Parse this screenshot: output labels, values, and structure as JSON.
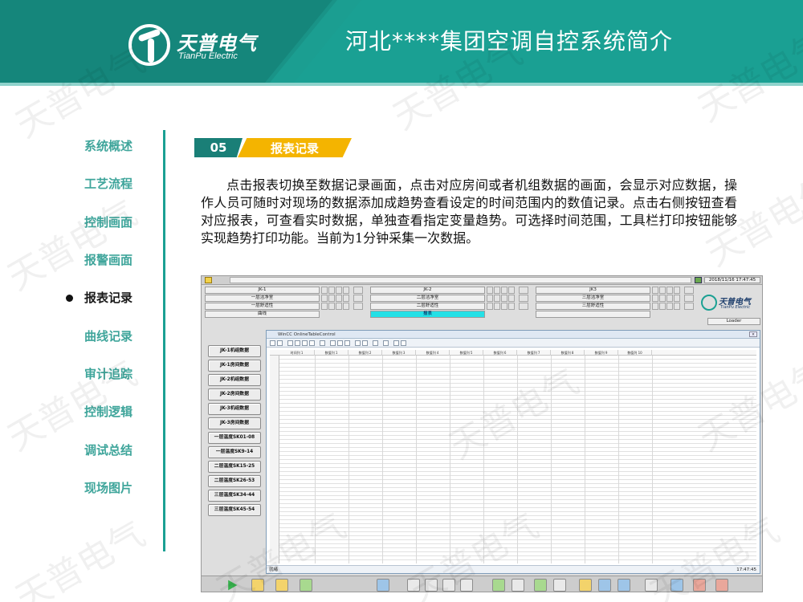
{
  "brand": {
    "name_cn": "天普电气",
    "name_en": "TianPu Electric"
  },
  "page": {
    "title": "河北****集团空调自控系统简介"
  },
  "watermark": "天普电气",
  "nav": {
    "items": [
      {
        "label": "系统概述",
        "active": false
      },
      {
        "label": "工艺流程",
        "active": false
      },
      {
        "label": "控制画面",
        "active": false
      },
      {
        "label": "报警画面",
        "active": false
      },
      {
        "label": "报表记录",
        "active": true
      },
      {
        "label": "曲线记录",
        "active": false
      },
      {
        "label": "审计追踪",
        "active": false
      },
      {
        "label": "控制逻辑",
        "active": false
      },
      {
        "label": "调试总结",
        "active": false
      },
      {
        "label": "现场图片",
        "active": false
      }
    ]
  },
  "section": {
    "number": "05",
    "title": "报表记录",
    "description": "点击报表切换至数据记录画面，点击对应房间或者机组数据的画面，会显示对应数据，操作人员可随时对现场的数据添加成趋势查看设定的时间范围内的数值记录。点击右侧按钮查看对应报表，可查看实时数据，单独查看指定变量趋势。可选择时间范围，工具栏打印按钮能够实现趋势打印功能。当前为1分钟采集一次数据。"
  },
  "scada": {
    "clock": "2018/11/16 17:47:45",
    "login_label": "Loader",
    "groups": [
      {
        "rows": [
          {
            "label": "JK-1",
            "highlight": false
          },
          {
            "label": "一层洁净室",
            "highlight": false
          },
          {
            "label": "一层舒适性",
            "highlight": false
          },
          {
            "label": "曲线",
            "highlight": false
          }
        ]
      },
      {
        "rows": [
          {
            "label": "JK-2",
            "highlight": false
          },
          {
            "label": "二层洁净室",
            "highlight": false
          },
          {
            "label": "二层舒适性",
            "highlight": false
          },
          {
            "label": "报表",
            "highlight": true
          }
        ]
      },
      {
        "rows": [
          {
            "label": "JK3",
            "highlight": false
          },
          {
            "label": "三层洁净室",
            "highlight": false
          },
          {
            "label": "三层舒适性",
            "highlight": false
          },
          {
            "label": "",
            "highlight": false
          }
        ]
      }
    ],
    "report_buttons": [
      "JK-1机组数据",
      "JK-1房间数据",
      "JK-2机组数据",
      "JK-2房间数据",
      "JK-3机组数据",
      "JK-3房间数据",
      "一层温度SK01-08",
      "一层温度SK9-14",
      "二层温度SK15-25",
      "二层温度SK26-53",
      "三层温度SK34-44",
      "三层温度SK45-54"
    ],
    "table_window": {
      "title": "WinCC OnlineTableControl",
      "columns": [
        "时间列 1",
        "数值列 1",
        "数值列 2",
        "数值列 3",
        "数值列 4",
        "数值列 5",
        "数值列 6",
        "数值列 7",
        "数值列 8",
        "数值列 9",
        "数值列 10"
      ],
      "status_left": "就绪",
      "status_right": "17:47:45"
    },
    "colors": {
      "highlight_button": "#24e0e6",
      "header_teal": "#1aa093",
      "section_gold": "#f4b400"
    }
  }
}
